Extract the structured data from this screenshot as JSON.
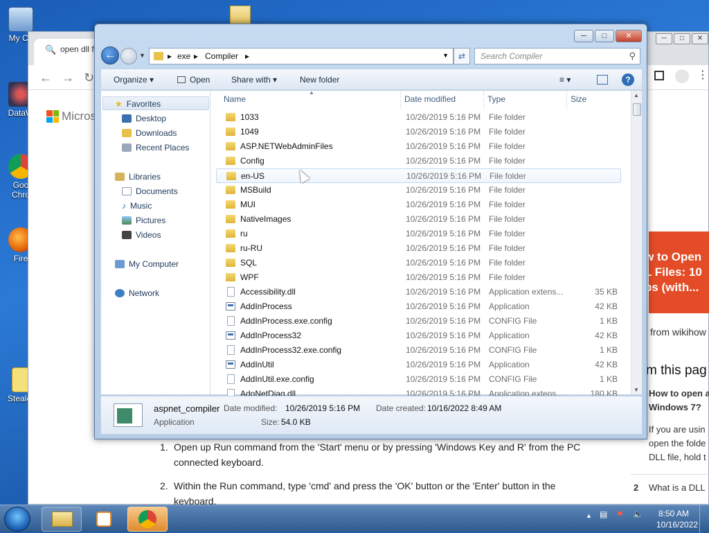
{
  "desktop": {
    "icons": [
      {
        "label": "My Co",
        "name": "my-computer"
      },
      {
        "label": "DataW",
        "name": "dataw"
      },
      {
        "label": "Goo",
        "name": "google-chrome",
        "label2": "Chro"
      },
      {
        "label": "Fire",
        "name": "firefox"
      },
      {
        "label": "Stealer",
        "name": "stealer"
      }
    ]
  },
  "browser": {
    "tab_text": "open dll fi",
    "ms_text": "Microsc",
    "wiki_promo": [
      "w to Open",
      "L Files: 10",
      "ps (with..."
    ],
    "from_text": "from wikihow",
    "in_this_page": "m this pag",
    "q1": [
      "How to open a",
      "Windows 7?"
    ],
    "p1": [
      "If you are usin",
      "open the folde",
      "DLL file, hold t"
    ],
    "q2_num": "2",
    "q2": "What is a DLL",
    "article": [
      "Open up Run command from the 'Start' menu or by pressing 'Windows Key and R' from the PC connected keyboard.",
      "Within the Run command, type 'cmd' and press the 'OK' button or the 'Enter' button in the keyboard."
    ],
    "article_nums": [
      "1.",
      "2."
    ]
  },
  "explorer": {
    "address": [
      "exe",
      "Compiler"
    ],
    "search_placeholder": "Search Compiler",
    "commands": {
      "organize": "Organize",
      "open": "Open",
      "share_with": "Share with",
      "new_folder": "New folder"
    },
    "nav": {
      "favorites": "Favorites",
      "desktop": "Desktop",
      "downloads": "Downloads",
      "recent_places": "Recent Places",
      "libraries": "Libraries",
      "documents": "Documents",
      "music": "Music",
      "pictures": "Pictures",
      "videos": "Videos",
      "my_computer": "My Computer",
      "network": "Network"
    },
    "columns": {
      "name": "Name",
      "date": "Date modified",
      "type": "Type",
      "size": "Size"
    },
    "files": [
      {
        "name": "1033",
        "date": "10/26/2019 5:16 PM",
        "type": "File folder",
        "size": "",
        "kind": "folder"
      },
      {
        "name": "1049",
        "date": "10/26/2019 5:16 PM",
        "type": "File folder",
        "size": "",
        "kind": "folder"
      },
      {
        "name": "ASP.NETWebAdminFiles",
        "date": "10/26/2019 5:16 PM",
        "type": "File folder",
        "size": "",
        "kind": "folder"
      },
      {
        "name": "Config",
        "date": "10/26/2019 5:16 PM",
        "type": "File folder",
        "size": "",
        "kind": "folder"
      },
      {
        "name": "en-US",
        "date": "10/26/2019 5:16 PM",
        "type": "File folder",
        "size": "",
        "kind": "folder"
      },
      {
        "name": "MSBuild",
        "date": "10/26/2019 5:16 PM",
        "type": "File folder",
        "size": "",
        "kind": "folder"
      },
      {
        "name": "MUI",
        "date": "10/26/2019 5:16 PM",
        "type": "File folder",
        "size": "",
        "kind": "folder"
      },
      {
        "name": "NativeImages",
        "date": "10/26/2019 5:16 PM",
        "type": "File folder",
        "size": "",
        "kind": "folder"
      },
      {
        "name": "ru",
        "date": "10/26/2019 5:16 PM",
        "type": "File folder",
        "size": "",
        "kind": "folder"
      },
      {
        "name": "ru-RU",
        "date": "10/26/2019 5:16 PM",
        "type": "File folder",
        "size": "",
        "kind": "folder"
      },
      {
        "name": "SQL",
        "date": "10/26/2019 5:16 PM",
        "type": "File folder",
        "size": "",
        "kind": "folder"
      },
      {
        "name": "WPF",
        "date": "10/26/2019 5:16 PM",
        "type": "File folder",
        "size": "",
        "kind": "folder"
      },
      {
        "name": "Accessibility.dll",
        "date": "10/26/2019 5:16 PM",
        "type": "Application extens...",
        "size": "35 KB",
        "kind": "dll"
      },
      {
        "name": "AddInProcess",
        "date": "10/26/2019 5:16 PM",
        "type": "Application",
        "size": "42 KB",
        "kind": "app"
      },
      {
        "name": "AddInProcess.exe.config",
        "date": "10/26/2019 5:16 PM",
        "type": "CONFIG File",
        "size": "1 KB",
        "kind": "cfg"
      },
      {
        "name": "AddInProcess32",
        "date": "10/26/2019 5:16 PM",
        "type": "Application",
        "size": "42 KB",
        "kind": "app"
      },
      {
        "name": "AddInProcess32.exe.config",
        "date": "10/26/2019 5:16 PM",
        "type": "CONFIG File",
        "size": "1 KB",
        "kind": "cfg"
      },
      {
        "name": "AddInUtil",
        "date": "10/26/2019 5:16 PM",
        "type": "Application",
        "size": "42 KB",
        "kind": "app"
      },
      {
        "name": "AddInUtil.exe.config",
        "date": "10/26/2019 5:16 PM",
        "type": "CONFIG File",
        "size": "1 KB",
        "kind": "cfg"
      },
      {
        "name": "AdoNetDiag.dll",
        "date": "10/26/2019 5:16 PM",
        "type": "Application extens...",
        "size": "180 KB",
        "kind": "dll"
      }
    ],
    "hover_index": 4,
    "details": {
      "name": "aspnet_compiler",
      "kind": "Application",
      "modified_label": "Date modified:",
      "modified": "10/26/2019 5:16 PM",
      "created_label": "Date created:",
      "created": "10/16/2022 8:49 AM",
      "size_label": "Size:",
      "size": "54.0 KB"
    }
  },
  "taskbar": {
    "time": "8:50 AM",
    "date": "10/16/2022"
  },
  "colors": {
    "desktop_blue": "#1b5fb0",
    "wikihow_red": "#e34c26",
    "folder_yellow": "#e8c14a"
  }
}
